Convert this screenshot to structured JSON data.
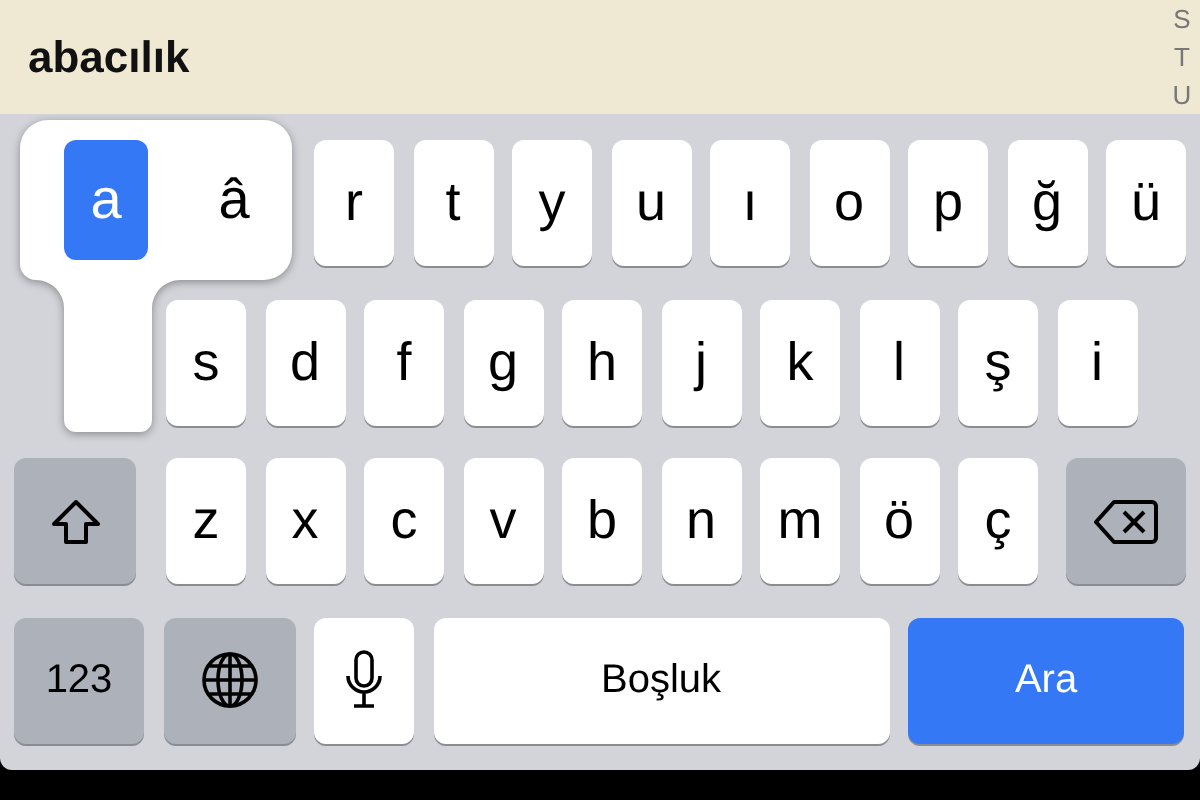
{
  "search": {
    "value": "abacılık"
  },
  "index_letters": [
    "S",
    "T",
    "U"
  ],
  "accent_popup": {
    "options": [
      {
        "label": "a",
        "selected": true
      },
      {
        "label": "â",
        "selected": false
      }
    ]
  },
  "rows": [
    {
      "keys": [
        {
          "kind": "letter",
          "label": "r"
        },
        {
          "kind": "letter",
          "label": "t"
        },
        {
          "kind": "letter",
          "label": "y"
        },
        {
          "kind": "letter",
          "label": "u"
        },
        {
          "kind": "letter",
          "label": "ı"
        },
        {
          "kind": "letter",
          "label": "o"
        },
        {
          "kind": "letter",
          "label": "p"
        },
        {
          "kind": "letter",
          "label": "ğ"
        },
        {
          "kind": "letter",
          "label": "ü"
        }
      ]
    },
    {
      "keys": [
        {
          "kind": "letter",
          "label": "s"
        },
        {
          "kind": "letter",
          "label": "d"
        },
        {
          "kind": "letter",
          "label": "f"
        },
        {
          "kind": "letter",
          "label": "g"
        },
        {
          "kind": "letter",
          "label": "h"
        },
        {
          "kind": "letter",
          "label": "j"
        },
        {
          "kind": "letter",
          "label": "k"
        },
        {
          "kind": "letter",
          "label": "l"
        },
        {
          "kind": "letter",
          "label": "ş"
        },
        {
          "kind": "letter",
          "label": "i"
        }
      ]
    },
    {
      "keys": [
        {
          "kind": "shift"
        },
        {
          "kind": "letter",
          "label": "z"
        },
        {
          "kind": "letter",
          "label": "x"
        },
        {
          "kind": "letter",
          "label": "c"
        },
        {
          "kind": "letter",
          "label": "v"
        },
        {
          "kind": "letter",
          "label": "b"
        },
        {
          "kind": "letter",
          "label": "n"
        },
        {
          "kind": "letter",
          "label": "m"
        },
        {
          "kind": "letter",
          "label": "ö"
        },
        {
          "kind": "letter",
          "label": "ç"
        },
        {
          "kind": "backspace"
        }
      ]
    },
    {
      "keys": [
        {
          "kind": "numbers",
          "label": "123"
        },
        {
          "kind": "globe"
        },
        {
          "kind": "mic"
        },
        {
          "kind": "space",
          "label": "Boşluk"
        },
        {
          "kind": "return",
          "label": "Ara"
        }
      ]
    }
  ]
}
